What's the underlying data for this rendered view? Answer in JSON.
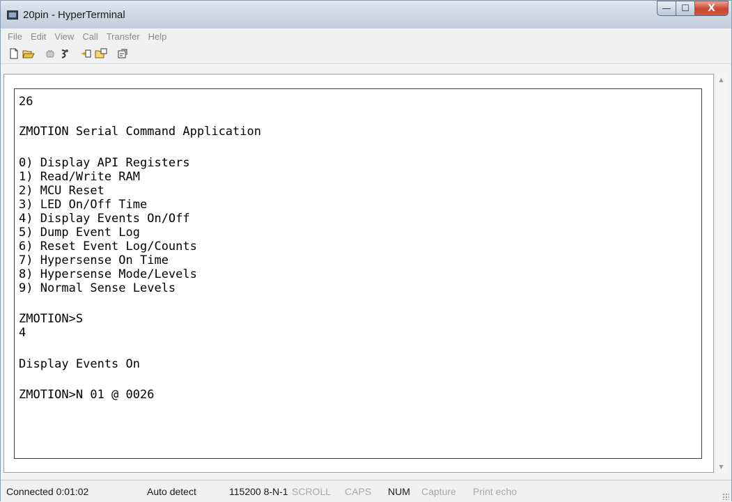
{
  "window": {
    "title": "20pin - HyperTerminal"
  },
  "caption_buttons": {
    "minimize": "—",
    "maximize": "☐",
    "close": "X"
  },
  "menu": [
    "File",
    "Edit",
    "View",
    "Call",
    "Transfer",
    "Help"
  ],
  "toolbar": [
    {
      "name": "new-icon"
    },
    {
      "name": "open-icon"
    },
    {
      "name": "connect-icon"
    },
    {
      "name": "disconnect-icon"
    },
    {
      "name": "send-icon"
    },
    {
      "name": "receive-icon"
    },
    {
      "name": "properties-icon"
    }
  ],
  "terminal": {
    "lines": [
      {
        "id": "l1",
        "text": "26"
      },
      {
        "id": "l2",
        "text": "ZMOTION Serial Command Application"
      },
      {
        "id": "l3",
        "text": "0) Display API Registers"
      },
      {
        "id": "l4",
        "text": "1) Read/Write RAM"
      },
      {
        "id": "l5",
        "text": "2) MCU Reset"
      },
      {
        "id": "l6",
        "text": "3) LED On/Off Time"
      },
      {
        "id": "l7",
        "text": "4) Display Events On/Off"
      },
      {
        "id": "l8",
        "text": "5) Dump Event Log"
      },
      {
        "id": "l9",
        "text": "6) Reset Event Log/Counts"
      },
      {
        "id": "l10",
        "text": "7) Hypersense On Time"
      },
      {
        "id": "l11",
        "text": "8) Hypersense Mode/Levels"
      },
      {
        "id": "l12",
        "text": "9) Normal Sense Levels"
      },
      {
        "id": "l13",
        "text": "ZMOTION>S"
      },
      {
        "id": "l14",
        "text": "4"
      },
      {
        "id": "l15",
        "text": "Display Events On"
      },
      {
        "id": "l16",
        "text": "ZMOTION>N 01 @ 0026"
      }
    ]
  },
  "status": {
    "connection": "Connected 0:01:02",
    "detect": "Auto detect",
    "settings": "115200 8-N-1",
    "scroll": "SCROLL",
    "caps": "CAPS",
    "num": "NUM",
    "capture": "Capture",
    "print_echo": "Print echo"
  },
  "colors": {
    "terminal_bg": "#ffffff",
    "terminal_text": "#000000",
    "menu_text": "#8a8a8a"
  }
}
